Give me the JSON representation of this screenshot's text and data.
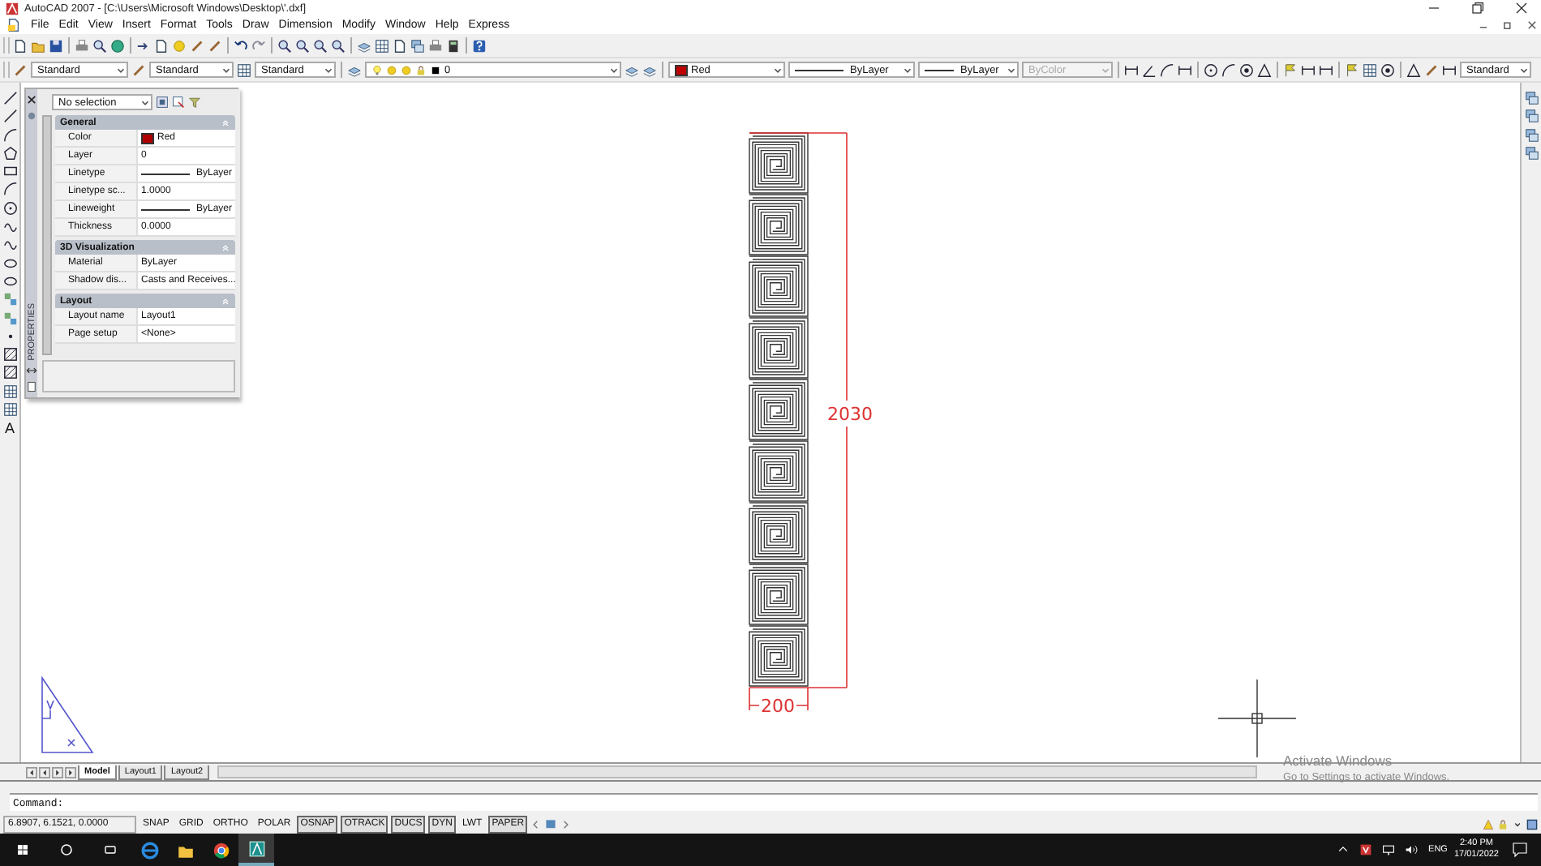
{
  "window": {
    "title": "AutoCAD 2007 - [C:\\Users\\Microsoft Windows\\Desktop\\'.dxf]"
  },
  "menu": [
    "File",
    "Edit",
    "View",
    "Insert",
    "Format",
    "Tools",
    "Draw",
    "Dimension",
    "Modify",
    "Window",
    "Help",
    "Express"
  ],
  "styles_toolbar": {
    "text_style": "Standard",
    "dim_style": "Standard",
    "table_style": "Standard",
    "layer": "0",
    "color": {
      "label": "Red",
      "color": "#c00000"
    },
    "linetype": "ByLayer",
    "lineweight": "ByLayer",
    "plot_style": {
      "label": "ByColor",
      "disabled": true
    },
    "multileader_style": "Standard"
  },
  "draw_toolbar": {
    "text_tool": "A"
  },
  "properties": {
    "title": "PROPERTIES",
    "selection": "No selection",
    "sections": [
      {
        "title": "General",
        "rows": [
          {
            "label": "Color",
            "value": "Red",
            "kind": "color",
            "color": "#b00000"
          },
          {
            "label": "Layer",
            "value": "0",
            "kind": "text"
          },
          {
            "label": "Linetype",
            "value": "ByLayer",
            "kind": "line"
          },
          {
            "label": "Linetype sc...",
            "value": "1.0000",
            "kind": "text"
          },
          {
            "label": "Lineweight",
            "value": "ByLayer",
            "kind": "line"
          },
          {
            "label": "Thickness",
            "value": "0.0000",
            "kind": "text"
          }
        ]
      },
      {
        "title": "3D Visualization",
        "rows": [
          {
            "label": "Material",
            "value": "ByLayer",
            "kind": "text"
          },
          {
            "label": "Shadow dis...",
            "value": "Casts and Receives...",
            "kind": "text"
          }
        ]
      },
      {
        "title": "Layout",
        "rows": [
          {
            "label": "Layout name",
            "value": "Layout1",
            "kind": "text"
          },
          {
            "label": "Page setup",
            "value": "<None>",
            "kind": "text"
          }
        ]
      }
    ]
  },
  "drawing": {
    "height_dimension": "2030",
    "width_dimension": "200"
  },
  "layout_tabs": [
    {
      "label": "Model",
      "selected": true
    },
    {
      "label": "Layout1",
      "selected": false
    },
    {
      "label": "Layout2",
      "selected": false
    }
  ],
  "command_line": {
    "prompt": "Command:"
  },
  "status_bar": {
    "coordinates": "6.8907, 6.1521, 0.0000",
    "toggles": [
      {
        "label": "SNAP",
        "on": false
      },
      {
        "label": "GRID",
        "on": false
      },
      {
        "label": "ORTHO",
        "on": false
      },
      {
        "label": "POLAR",
        "on": false
      },
      {
        "label": "OSNAP",
        "on": true
      },
      {
        "label": "OTRACK",
        "on": true
      },
      {
        "label": "DUCS",
        "on": true
      },
      {
        "label": "DYN",
        "on": true
      },
      {
        "label": "LWT",
        "on": false
      },
      {
        "label": "PAPER",
        "on": true
      }
    ]
  },
  "activation_notice": {
    "title": "Activate Windows",
    "detail": "Go to Settings to activate Windows."
  },
  "taskbar": {
    "apps": [
      {
        "kind": "browser-e",
        "selected": false
      },
      {
        "kind": "folder",
        "selected": false
      },
      {
        "kind": "chrome",
        "selected": false
      },
      {
        "kind": "autocad",
        "selected": true
      }
    ],
    "language": "ENG",
    "time": "2:40 PM",
    "date": "17/01/2022"
  }
}
